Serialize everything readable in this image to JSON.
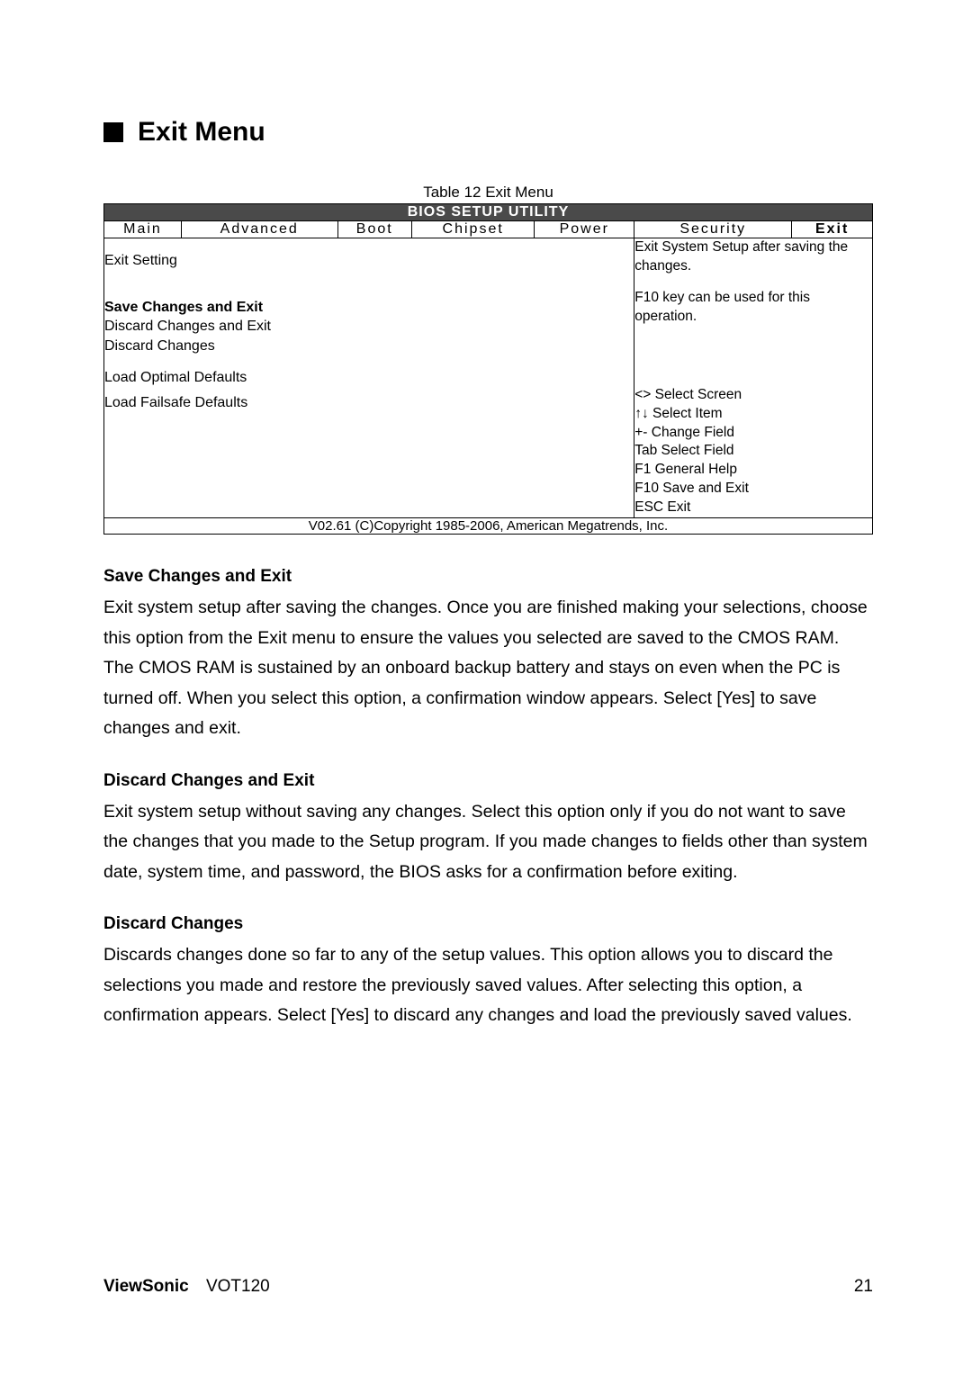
{
  "page": {
    "section_title": "Exit Menu",
    "table_caption": "Table 12 Exit Menu",
    "utility_header": "BIOS SETUP UTILITY",
    "tabs": [
      "Main",
      "Advanced",
      "Boot",
      "Chipset",
      "Power",
      "Security",
      "Exit"
    ],
    "left_panel": {
      "exit_setting": "Exit Setting",
      "save_exit": "Save Changes and Exit",
      "discard_exit": "Discard Changes and Exit",
      "discard": "Discard Changes",
      "load_optimal": "Load Optimal Defaults",
      "load_failsafe": "Load Failsafe Defaults"
    },
    "right_panel": {
      "desc1": "Exit System Setup after saving the changes.",
      "desc2": "F10 key can be used for this operation.",
      "hint1": "<> Select Screen",
      "hint2": "↑↓ Select Item",
      "hint3": "+- Change Field",
      "hint4": "Tab Select Field",
      "hint5": "F1 General Help",
      "hint6": "F10 Save and Exit",
      "hint7": "ESC Exit"
    },
    "copyright": "V02.61 (C)Copyright 1985-2006, American Megatrends, Inc."
  },
  "body": {
    "h1": "Save Changes and Exit",
    "p1": "Exit system setup after saving the changes. Once you are finished making your selections, choose this option from the Exit menu to ensure the values you selected are saved to the CMOS RAM. The CMOS RAM is sustained by an onboard backup battery and stays on even when the PC is turned off. When you select this option, a confirmation window appears. Select [Yes] to save changes and exit.",
    "h2": "Discard Changes and Exit",
    "p2": "Exit system setup without saving any changes. Select this option only if you do not want to save the changes that you made to the Setup program. If you made changes to fields other than system date, system time, and password, the BIOS asks for a confirmation before exiting.",
    "h3": "Discard Changes",
    "p3": "Discards changes done so far to any of the setup values. This option allows you to discard the selections you made and restore the previously saved values. After selecting this option, a confirmation appears. Select [Yes] to discard any changes and load the previously saved values."
  },
  "footer": {
    "brand": "ViewSonic",
    "model": "VOT120",
    "page_no": "21"
  }
}
